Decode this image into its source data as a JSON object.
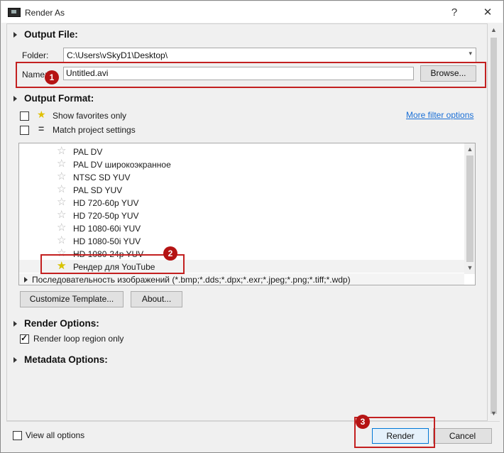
{
  "window": {
    "title": "Render As",
    "help_glyph": "?",
    "close_glyph": "✕"
  },
  "output_file": {
    "section_label": "Output File:",
    "folder_label": "Folder:",
    "folder_value": "C:\\Users\\vSkyD1\\Desktop\\",
    "name_label": "Name:",
    "name_value": "Untitled.avi",
    "browse_label": "Browse..."
  },
  "output_format": {
    "section_label": "Output Format:",
    "show_favorites_label": "Show favorites only",
    "show_favorites_checked": false,
    "match_project_label": "Match project settings",
    "match_project_checked": false,
    "more_filter_link": "More filter options",
    "templates": [
      {
        "label": "PAL DV",
        "favorite": false
      },
      {
        "label": "PAL DV широкоэкранное",
        "favorite": false
      },
      {
        "label": "NTSC SD YUV",
        "favorite": false
      },
      {
        "label": "PAL SD YUV",
        "favorite": false
      },
      {
        "label": "HD 720-60p YUV",
        "favorite": false
      },
      {
        "label": "HD 720-50p YUV",
        "favorite": false
      },
      {
        "label": "HD 1080-60i YUV",
        "favorite": false
      },
      {
        "label": "HD 1080-50i YUV",
        "favorite": false
      },
      {
        "label": "HD 1080-24p YUV",
        "favorite": false
      },
      {
        "label": "Рендер для YouTube",
        "favorite": true,
        "selected": true
      }
    ],
    "format_group_label": "Последовательность изображений (*.bmp;*.dds;*.dpx;*.exr;*.jpeg;*.png;*.tiff;*.wdp)",
    "customize_label": "Customize Template...",
    "about_label": "About..."
  },
  "render_options": {
    "section_label": "Render Options:",
    "loop_region_label": "Render loop region only",
    "loop_region_checked": true
  },
  "metadata_options": {
    "section_label": "Metadata Options:"
  },
  "footer": {
    "view_all_label": "View all options",
    "view_all_checked": false,
    "render_label": "Render",
    "cancel_label": "Cancel"
  },
  "annotations": {
    "badge_1": "1",
    "badge_2": "2",
    "badge_3": "3",
    "color": "#c32020"
  }
}
